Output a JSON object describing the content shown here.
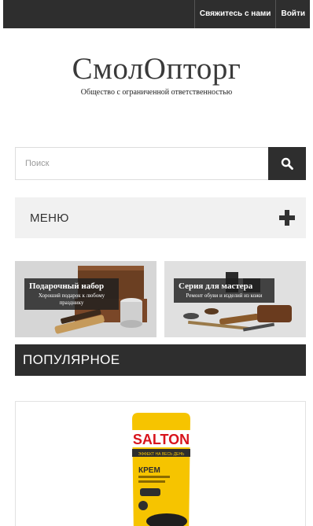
{
  "topbar": {
    "contact_label": "Свяжитесь с нами",
    "login_label": "Войти"
  },
  "logo": {
    "name": "СмолОпторг",
    "tagline": "Общество с ограниченной ответственностью"
  },
  "search": {
    "placeholder": "Поиск",
    "value": ""
  },
  "menu": {
    "label": "МЕНЮ"
  },
  "banners": [
    {
      "title": "Подарочный набор",
      "subtitle": "Хороший подарок к любому празднику"
    },
    {
      "title": "Серия для мастера",
      "subtitle": "Ремонт обуви и изделий из кожи"
    }
  ],
  "popular": {
    "label": "ПОПУЛЯРНОЕ"
  },
  "product": {
    "brand": "SALTON",
    "strip": "ЭФФЕКТ НА ВЕСЬ ДЕНЬ",
    "type": "КРЕМ"
  },
  "colors": {
    "dark": "#2e2e2e",
    "menu_bg": "#f1f1f1",
    "salton_yellow": "#f6c400",
    "salton_red": "#d8141c"
  }
}
